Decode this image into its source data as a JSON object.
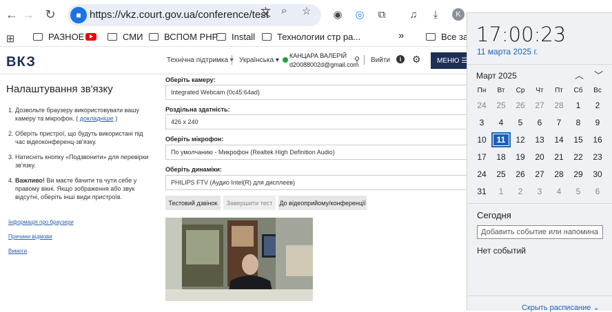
{
  "browser": {
    "url": "https://vkz.court.gov.ua/conference/test",
    "profile_initial": "K",
    "bookmarks": [
      {
        "label": "РАЗНОЕ",
        "icon": "folder-icon"
      },
      {
        "label": "СМИ",
        "icon": "youtube-icon"
      },
      {
        "label": "ВСПОМ PHP",
        "icon": "folder-icon"
      },
      {
        "label": "Install",
        "icon": "folder-icon"
      },
      {
        "label": "Технологии стр ра...",
        "icon": "folder-icon"
      },
      {
        "label": "Все закл",
        "icon": "folder-icon"
      }
    ],
    "bookmarks_overflow": "»"
  },
  "site": {
    "logo": "ВКЗ",
    "support": "Технічна підтримка ▾",
    "language": "Українська ▾",
    "user_name": "КАНЦАРА ВАЛЕРІЙ",
    "user_email": "d20088002d@gmail.com",
    "logout": "Вийти",
    "menu": "МЕНЮ"
  },
  "sidebar": {
    "title": "Налаштування зв'язку",
    "steps": [
      {
        "num": "1.",
        "text": "Дозвольте браузеру використовувати вашу камеру та мікрофон. (",
        "link": "докладніше",
        "suffix": ")"
      },
      {
        "num": "2.",
        "text": "Оберіть пристрої, що будуть використані під час відеоконференц-зв'язку."
      },
      {
        "num": "3.",
        "text": "Натисніть кнопку «Подзвонити» для перевірки зв'язку."
      },
      {
        "num": "4.",
        "bold": "Важливо!",
        "text": " Ви маєте бачити та чути себе у правому вікні. Якщо зображення або звук відсутні, оберіть інші види пристроїв."
      }
    ],
    "links": [
      "Інформація про браузери",
      "Причини відмови",
      "Вимоги"
    ]
  },
  "form": {
    "camera_label": "Оберіть камеру:",
    "camera_value": "Integrated Webcam (0c45:64ad)",
    "resolution_label": "Роздільна здатність:",
    "resolution_value": "426 x 240",
    "mic_label": "Оберіть мікрофон:",
    "mic_value": "По умолчанию - Микрофон (Realtek High Definition Audio)",
    "speaker_label": "Оберіть динаміки:",
    "speaker_value": "PHILIPS FTV (Аудио Intel(R) для дисплеев)",
    "btn_test_call": "Тестовий дзвінок",
    "btn_finish_test": "Завершити тест",
    "btn_to_room": "До відеоприйому/конференції"
  },
  "calendar": {
    "time": "17:00:23",
    "date": "11 марта 2025 г.",
    "month": "Март 2025",
    "weekdays": [
      "Пн",
      "Вт",
      "Ср",
      "Чт",
      "Пт",
      "Сб",
      "Вс"
    ],
    "days": [
      [
        "24",
        "25",
        "26",
        "27",
        "28",
        "1",
        "2"
      ],
      [
        "3",
        "4",
        "5",
        "6",
        "7",
        "8",
        "9"
      ],
      [
        "10",
        "11",
        "12",
        "13",
        "14",
        "15",
        "16"
      ],
      [
        "17",
        "18",
        "19",
        "20",
        "21",
        "22",
        "23"
      ],
      [
        "24",
        "25",
        "26",
        "27",
        "28",
        "29",
        "30"
      ],
      [
        "31",
        "1",
        "2",
        "3",
        "4",
        "5",
        "6"
      ]
    ],
    "today_label": "Сегодня",
    "add_event_placeholder": "Добавить событие или напомина",
    "no_events": "Нет событий",
    "hide_schedule": "Скрыть расписание ⌄"
  },
  "colors": {
    "accent": "#1c60b7",
    "brand": "#1c2f57",
    "online": "#1ea33b"
  }
}
